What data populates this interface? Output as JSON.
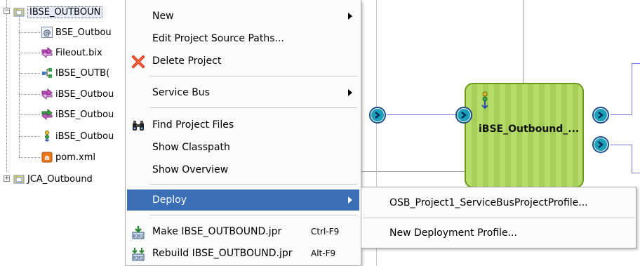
{
  "tree": {
    "items": [
      {
        "label": "IBSE_OUTBOUN",
        "icon": "project-folder-icon"
      },
      {
        "label": "BSE_Outbou",
        "icon": "at-sign-icon"
      },
      {
        "label": "Fileout.bix",
        "icon": "business-service-icon"
      },
      {
        "label": "IBSE_OUTB(",
        "icon": "pipeline-icon"
      },
      {
        "label": "iBSE_Outbou",
        "icon": "business-service-icon"
      },
      {
        "label": "iBSE_Outbou",
        "icon": "proxy-service-icon"
      },
      {
        "label": "iBSE_Outbou",
        "icon": "adapter-icon"
      },
      {
        "label": "pom.xml",
        "icon": "maven-file-icon"
      },
      {
        "label": "JCA_Outbound",
        "icon": "project-folder-icon"
      }
    ]
  },
  "menu": {
    "items": [
      {
        "label": "New",
        "has_submenu": true
      },
      {
        "label": "Edit Project Source Paths...",
        "has_submenu": false
      },
      {
        "label": "Delete Project",
        "has_submenu": false,
        "icon": "delete-x-icon"
      },
      {
        "label": "Service Bus",
        "has_submenu": true
      },
      {
        "label": "Find Project Files",
        "has_submenu": false,
        "icon": "binoculars-icon"
      },
      {
        "label": "Show Classpath",
        "has_submenu": false
      },
      {
        "label": "Show Overview",
        "has_submenu": false
      },
      {
        "label": "Deploy",
        "has_submenu": true,
        "active": true
      },
      {
        "label": "Make IBSE_OUTBOUND.jpr",
        "shortcut": "Ctrl-F9",
        "icon": "make-icon"
      },
      {
        "label": "Rebuild IBSE_OUTBOUND.jpr",
        "shortcut": "Alt-F9",
        "icon": "rebuild-icon"
      }
    ]
  },
  "submenu": {
    "items": [
      {
        "label": "OSB_Project1_ServiceBusProjectProfile..."
      },
      {
        "label": "New Deployment Profile..."
      }
    ]
  },
  "canvas": {
    "component_title": "iBSE_Outbound_..."
  },
  "colors": {
    "menu_highlight": "#3a6fb6",
    "component_fill": "#b6dc6c",
    "component_border": "#6a9a1a",
    "port_fill": "#1aa0b8",
    "wire": "#6f7fdc"
  }
}
